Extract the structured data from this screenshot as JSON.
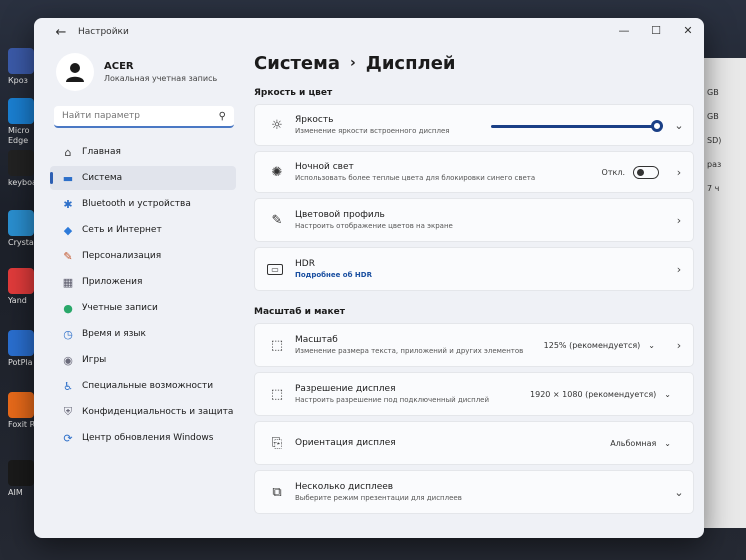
{
  "desktop": {
    "icons": [
      {
        "label": "Кроз",
        "color": "#3b5aa8"
      },
      {
        "label": "Micro Edge",
        "color": "#1a7fd1"
      },
      {
        "label": "keyboa",
        "color": "#222222"
      },
      {
        "label": "CrystalD",
        "color": "#2a8fd0"
      },
      {
        "label": "Yand",
        "color": "#e23b3b"
      },
      {
        "label": "PotPla",
        "color": "#2a6fd0"
      },
      {
        "label": "Foxit Re",
        "color": "#e86a1a"
      },
      {
        "label": "AIM",
        "color": "#1a1a1a"
      }
    ],
    "right_window_lines": [
      "GB",
      "GB",
      "SD)",
      "раз",
      "7 ч"
    ]
  },
  "window": {
    "app_title": "Настройки",
    "controls": {
      "minimize": "—",
      "maximize": "☐",
      "close": "✕"
    }
  },
  "profile": {
    "name": "ACER",
    "subtitle": "Локальная учетная запись"
  },
  "search": {
    "placeholder": "Найти параметр"
  },
  "nav": [
    {
      "label": "Главная",
      "icon": "home-icon",
      "glyph": "⌂",
      "color": "#444444"
    },
    {
      "label": "Система",
      "icon": "system-icon",
      "glyph": "▬",
      "color": "#2d6fc9"
    },
    {
      "label": "Bluetooth и устройства",
      "icon": "bluetooth-icon",
      "glyph": "✱",
      "color": "#2d6fc9"
    },
    {
      "label": "Сеть и Интернет",
      "icon": "network-icon",
      "glyph": "◆",
      "color": "#2d7ad9"
    },
    {
      "label": "Персонализация",
      "icon": "brush-icon",
      "glyph": "✎",
      "color": "#c2542a"
    },
    {
      "label": "Приложения",
      "icon": "apps-icon",
      "glyph": "▦",
      "color": "#5a5a6a"
    },
    {
      "label": "Учетные записи",
      "icon": "account-icon",
      "glyph": "●",
      "color": "#2aa86a"
    },
    {
      "label": "Время и язык",
      "icon": "clock-globe-icon",
      "glyph": "◷",
      "color": "#2d6fc9"
    },
    {
      "label": "Игры",
      "icon": "gamepad-icon",
      "glyph": "◉",
      "color": "#6a6a7a"
    },
    {
      "label": "Специальные возможности",
      "icon": "accessibility-icon",
      "glyph": "♿",
      "color": "#2d6fc9"
    },
    {
      "label": "Конфиденциальность и защита",
      "icon": "shield-icon",
      "glyph": "⛨",
      "color": "#6a6a7a"
    },
    {
      "label": "Центр обновления Windows",
      "icon": "update-icon",
      "glyph": "⟳",
      "color": "#2d6fc9"
    }
  ],
  "active_nav_index": 1,
  "breadcrumb": {
    "parent": "Система",
    "separator": "›",
    "current": "Дисплей"
  },
  "section_brightness": {
    "title": "Яркость и цвет",
    "brightness": {
      "title": "Яркость",
      "subtitle": "Изменение яркости встроенного дисплея",
      "level_percent": 100
    },
    "night_light": {
      "title": "Ночной свет",
      "subtitle": "Использовать более теплые цвета для блокировки синего света",
      "state_label": "Откл."
    },
    "color_profile": {
      "title": "Цветовой профиль",
      "subtitle": "Настроить отображение цветов на экране"
    },
    "hdr": {
      "title": "HDR",
      "subtitle": "Подробнее об HDR"
    }
  },
  "section_scale": {
    "title": "Масштаб и макет",
    "scale": {
      "title": "Масштаб",
      "subtitle": "Изменение размера текста, приложений и других элементов",
      "value": "125% (рекомендуется)"
    },
    "resolution": {
      "title": "Разрешение дисплея",
      "subtitle": "Настроить разрешение под подключенный дисплей",
      "value": "1920 × 1080 (рекомендуется)"
    },
    "orientation": {
      "title": "Ориентация дисплея",
      "value": "Альбомная"
    },
    "multiple": {
      "title": "Несколько дисплеев",
      "subtitle": "Выберите режим презентации для дисплеев"
    }
  }
}
